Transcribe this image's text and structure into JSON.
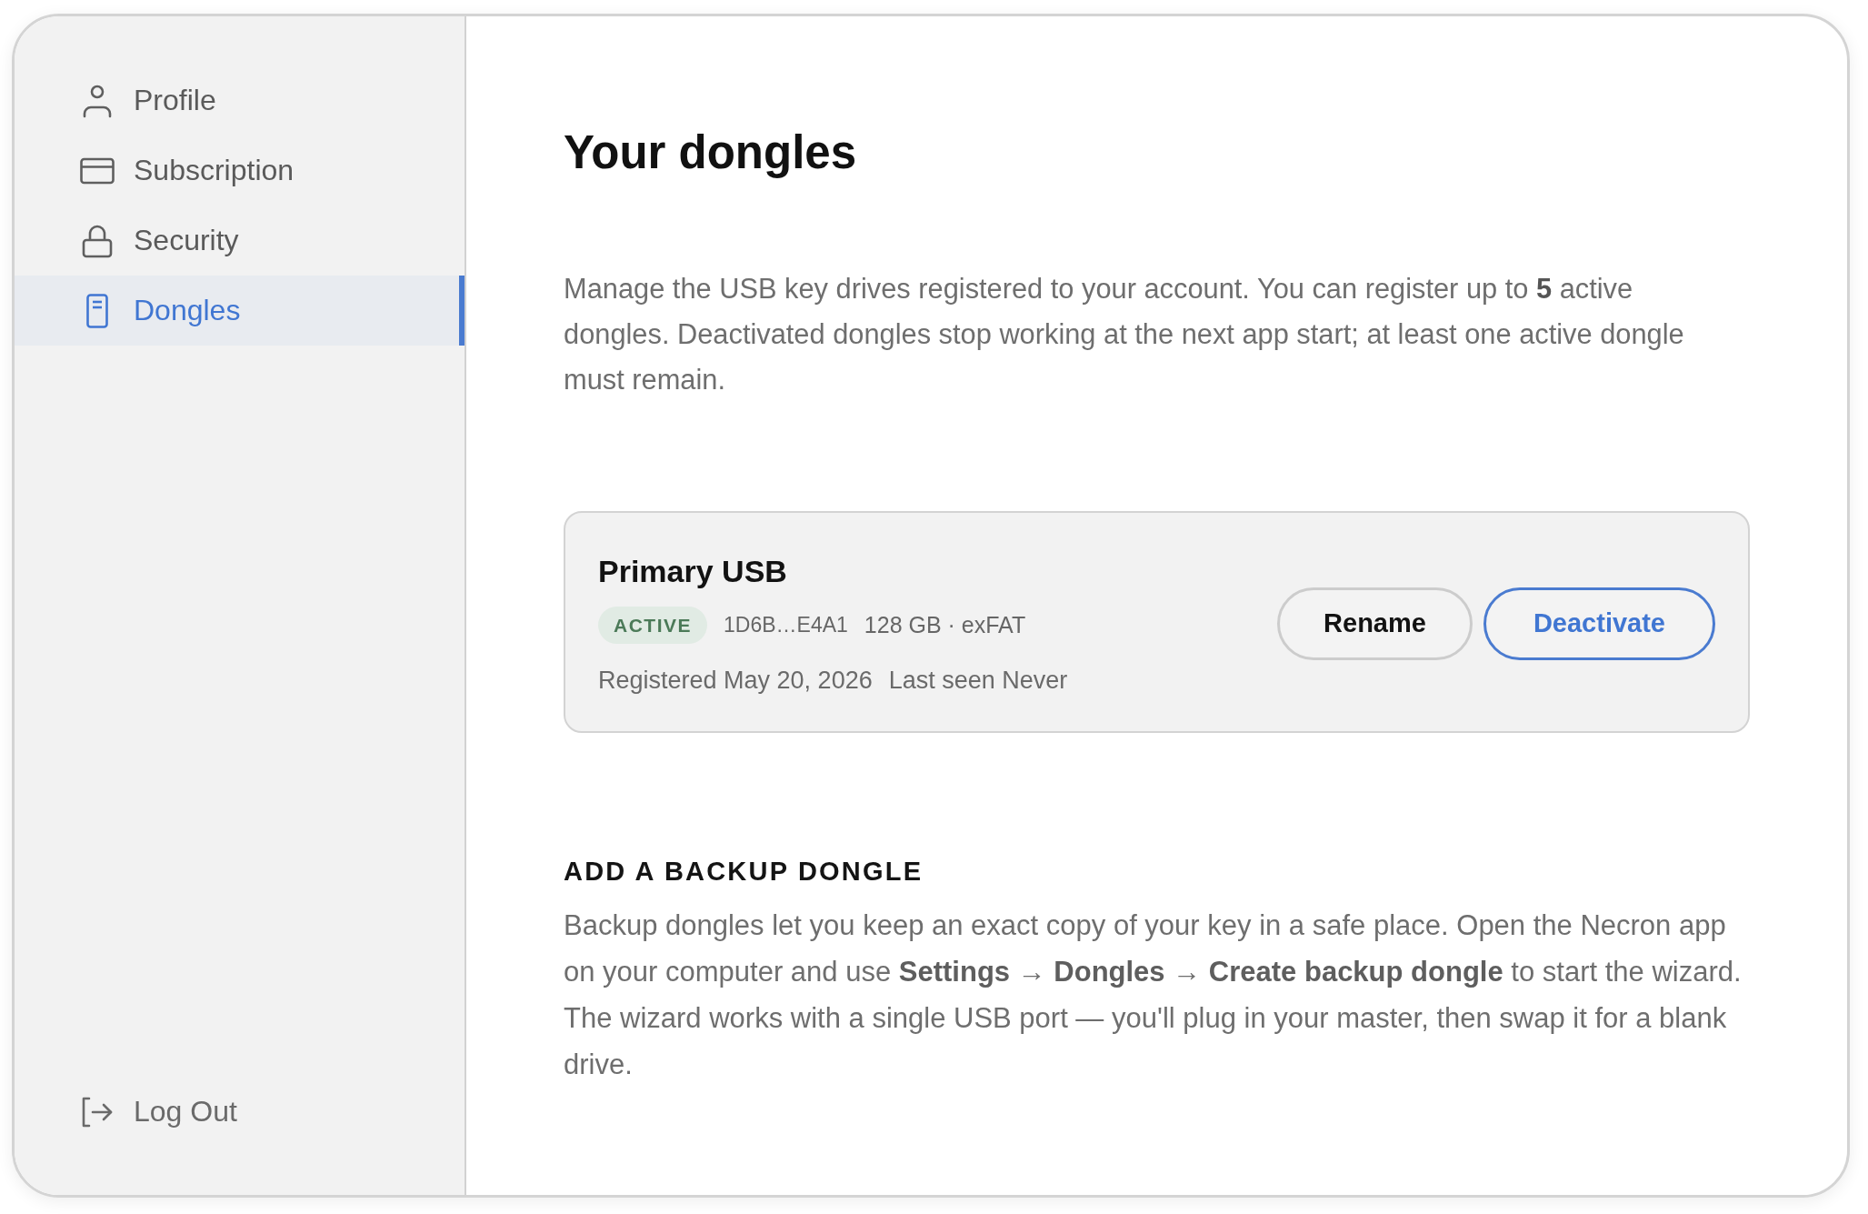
{
  "sidebar": {
    "items": [
      {
        "label": "Profile",
        "selected": false
      },
      {
        "label": "Subscription",
        "selected": false
      },
      {
        "label": "Security",
        "selected": false
      },
      {
        "label": "Dongles",
        "selected": true
      }
    ],
    "logout": {
      "label": "Log Out"
    }
  },
  "main": {
    "title": "Your dongles",
    "description": "Manage the USB key drives registered to your account. You can register up to **5** active dongles. Deactivated dongles stop working at the next app start; at least one active dongle must remain.",
    "dongles": [
      {
        "name": "Primary USB",
        "status": "ACTIVE",
        "serial": "1D6B…E4A1",
        "details": "128 GB · exFAT",
        "registered": "Registered May 20, 2026",
        "last_seen": "Last seen Never",
        "actions": [
          {
            "label": "Rename",
            "kind": "neutral"
          },
          {
            "label": "Deactivate",
            "kind": "accent"
          }
        ]
      }
    ],
    "backup": {
      "heading": "ADD A BACKUP DONGLE",
      "text": "Backup dongles let you keep an exact copy of your key in a safe place. Open the Necron app on your computer and use **Settings** → **Dongles** → **Create backup dongle** to start the wizard. The wizard works with a single USB port — you'll plug in your master, then swap it for a blank drive."
    }
  }
}
